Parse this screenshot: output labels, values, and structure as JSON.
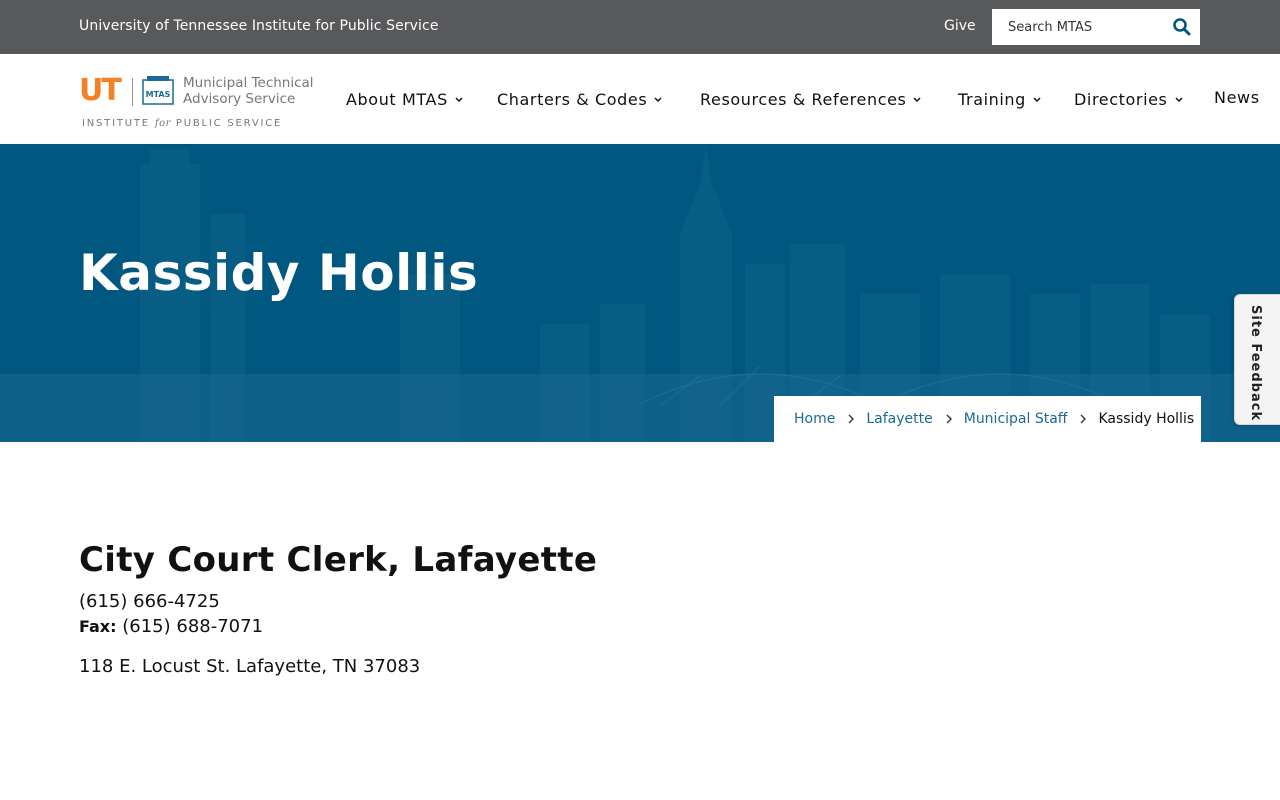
{
  "topbar": {
    "institute_link": "University of Tennessee Institute for Public Service",
    "give_link": "Give",
    "search_placeholder": "Search MTAS"
  },
  "logo": {
    "ut_mark": "UT",
    "seal_text": "MTAS",
    "name_line1": "Municipal Technical",
    "name_line2": "Advisory Service",
    "ips_pre": "INSTITUTE",
    "ips_for": "for",
    "ips_post": "PUBLIC SERVICE"
  },
  "nav": {
    "items": [
      {
        "label": "About MTAS",
        "has_menu": true
      },
      {
        "label": "Charters & Codes",
        "has_menu": true
      },
      {
        "label": "Resources & References",
        "has_menu": true
      },
      {
        "label": "Training",
        "has_menu": true
      },
      {
        "label": "Directories",
        "has_menu": true
      },
      {
        "label": "News",
        "has_menu": false
      }
    ]
  },
  "hero": {
    "title": "Kassidy Hollis"
  },
  "breadcrumb": {
    "items": [
      "Home",
      "Lafayette",
      "Municipal Staff"
    ],
    "current": "Kassidy Hollis"
  },
  "feedback_tab": "Site Feedback",
  "contact": {
    "position": "City Court Clerk, Lafayette",
    "phone": "(615) 666-4725",
    "fax_label": "Fax:",
    "fax": "(615) 688-7071",
    "address": "118 E. Locust St. Lafayette, TN 37083"
  },
  "colors": {
    "topbar_bg": "#58595b",
    "hero_bg": "#00577f",
    "link": "#1a6a95",
    "ut_orange": "#f58025",
    "search_icon": "#00577f"
  }
}
